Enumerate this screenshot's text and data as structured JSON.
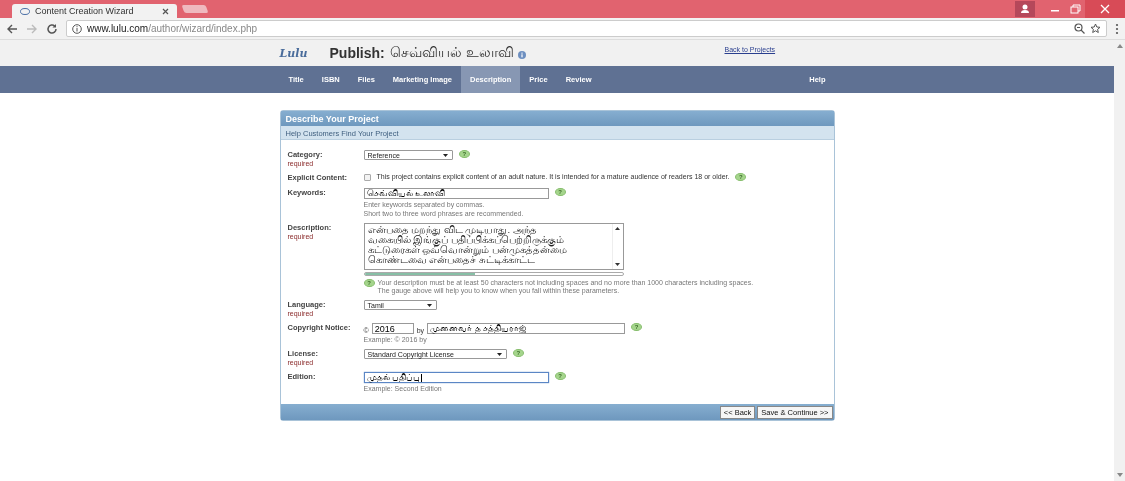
{
  "browser": {
    "tab_title": "Content Creation Wizard",
    "url_host": "www.lulu.com",
    "url_path": "/author/wizard/index.php"
  },
  "header": {
    "logo": "Lulu",
    "title_prefix": "Publish:",
    "title": "செவ்வியல் உலாவி",
    "back_link": "Back to Projects"
  },
  "nav": [
    {
      "label": "Title",
      "selected": false
    },
    {
      "label": "ISBN",
      "selected": false
    },
    {
      "label": "Files",
      "selected": false
    },
    {
      "label": "Marketing Image",
      "selected": false
    },
    {
      "label": "Description",
      "selected": true
    },
    {
      "label": "Price",
      "selected": false
    },
    {
      "label": "Review",
      "selected": false
    },
    {
      "label": "Help",
      "selected": false
    }
  ],
  "panel": {
    "title": "Describe Your Project",
    "subtitle": "Help Customers Find Your Project",
    "fields": [
      {
        "kind": "select",
        "label": "Category:",
        "note": "required",
        "value": "Reference",
        "help": "?"
      },
      {
        "kind": "checkbox",
        "label": "Explicit Content:",
        "checked": false,
        "text": "This project contains explicit content of an adult nature. It is intended for a mature audience of readers 18 or older.",
        "help": "?"
      },
      {
        "kind": "input",
        "label": "Keywords:",
        "value": "செவ்வியல் உலாவி",
        "focused": false,
        "hints": [
          "Enter keywords separated by commas.",
          "Short two to three word phrases are recommended."
        ],
        "help": "?"
      },
      {
        "kind": "textarea",
        "label": "Description:",
        "note": "required",
        "lines": [
          "என்பதை மறந்து விட முடியாது. அந்த",
          "வகையில் இங்குப் பதிப்பிக்கப்பெற்றிருக்கும்",
          "கட்டுரைகள் ஒவ்வொன்றும் பன்முகத்தன்மை",
          "கொண்டவை என்பதைச் சுட்டிக்காட்ட"
        ],
        "level": 0.43,
        "hints": [
          "Your description must be at least 50 characters not including spaces and no more than 1000 characters including spaces.",
          "The gauge above will help you to know when you fall within these parameters."
        ],
        "help": "?"
      },
      {
        "kind": "select",
        "label": "Language:",
        "note": "required",
        "value": "Tamil"
      },
      {
        "kind": "copyright",
        "label": "Copyright Notice:",
        "symbol": "©",
        "year": "2016",
        "by": "by",
        "name": "முனைவர் த சத்தியராஜ்",
        "hints": [
          "Example: © 2016 by"
        ],
        "help": "?"
      },
      {
        "kind": "select",
        "label": "License:",
        "note": "required",
        "value": "Standard Copyright License",
        "help": "?"
      },
      {
        "kind": "input",
        "label": "Edition:",
        "value": "முதல் பதிப்பு",
        "focused": true,
        "hints": [
          "Example: Second Edition"
        ],
        "help": "?"
      }
    ],
    "buttons": [
      "<< Back",
      "Save & Continue >>"
    ]
  }
}
